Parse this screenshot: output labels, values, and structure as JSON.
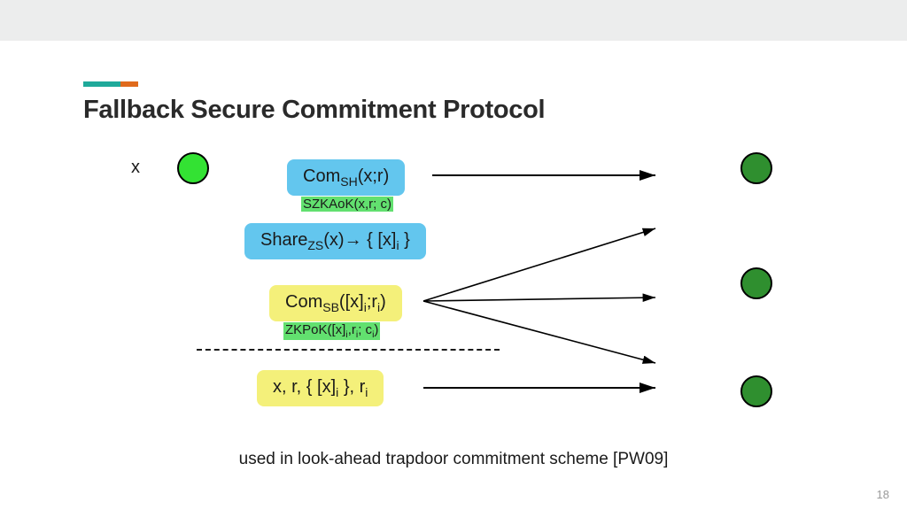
{
  "slide": {
    "title": "Fallback Secure Commitment Protocol",
    "x_label": "x",
    "caption": "used in look-ahead trapdoor commitment scheme [PW09]",
    "page_number": "18"
  },
  "boxes": {
    "com_sh": {
      "text": "Com",
      "sub": "SH",
      "tail": "(x;r)"
    },
    "szkaok": {
      "text": "SZKAoK(x,r; c)"
    },
    "share": {
      "text": "Share",
      "sub": "ZS",
      "tail": "(x)→ { [x]",
      "tail_sub": "i",
      "tail2": " }"
    },
    "com_sb": {
      "text": "Com",
      "sub": "SB",
      "tail": "([x]",
      "tail_sub": "i",
      "tail2": ";r",
      "tail2_sub": "i",
      "tail3": ")"
    },
    "zkpok": {
      "text": "ZKPoK([x]",
      "sub": "i",
      "text2": ",r",
      "sub2": "i",
      "text3": "; c",
      "sub3": "i",
      "text4": ")"
    },
    "reveal": {
      "text": "x, r, { [x]",
      "sub": "i",
      "text2": " }, r",
      "sub2": "i"
    }
  },
  "chart_data": {
    "type": "table",
    "title": "Fallback Secure Commitment Protocol — message flow",
    "parties": {
      "sender": 1,
      "receivers": 3
    },
    "steps": [
      {
        "label": "Com_SH(x;r)",
        "proof": "SZKAoK(x,r; c)",
        "from": "sender",
        "to": [
          "receiver1"
        ]
      },
      {
        "label": "Share_ZS(x) → { [x]_i }",
        "from": "sender",
        "to": []
      },
      {
        "label": "Com_SB([x]_i; r_i)",
        "proof": "ZKPoK([x]_i, r_i; c_i)",
        "from": "sender",
        "to": [
          "receiver1",
          "receiver2",
          "receiver3"
        ]
      },
      {
        "divider": true
      },
      {
        "label": "x, r, { [x]_i }, r_i",
        "from": "sender",
        "to": [
          "receiver2"
        ]
      }
    ],
    "footnote": "used in look-ahead trapdoor commitment scheme [PW09]"
  }
}
